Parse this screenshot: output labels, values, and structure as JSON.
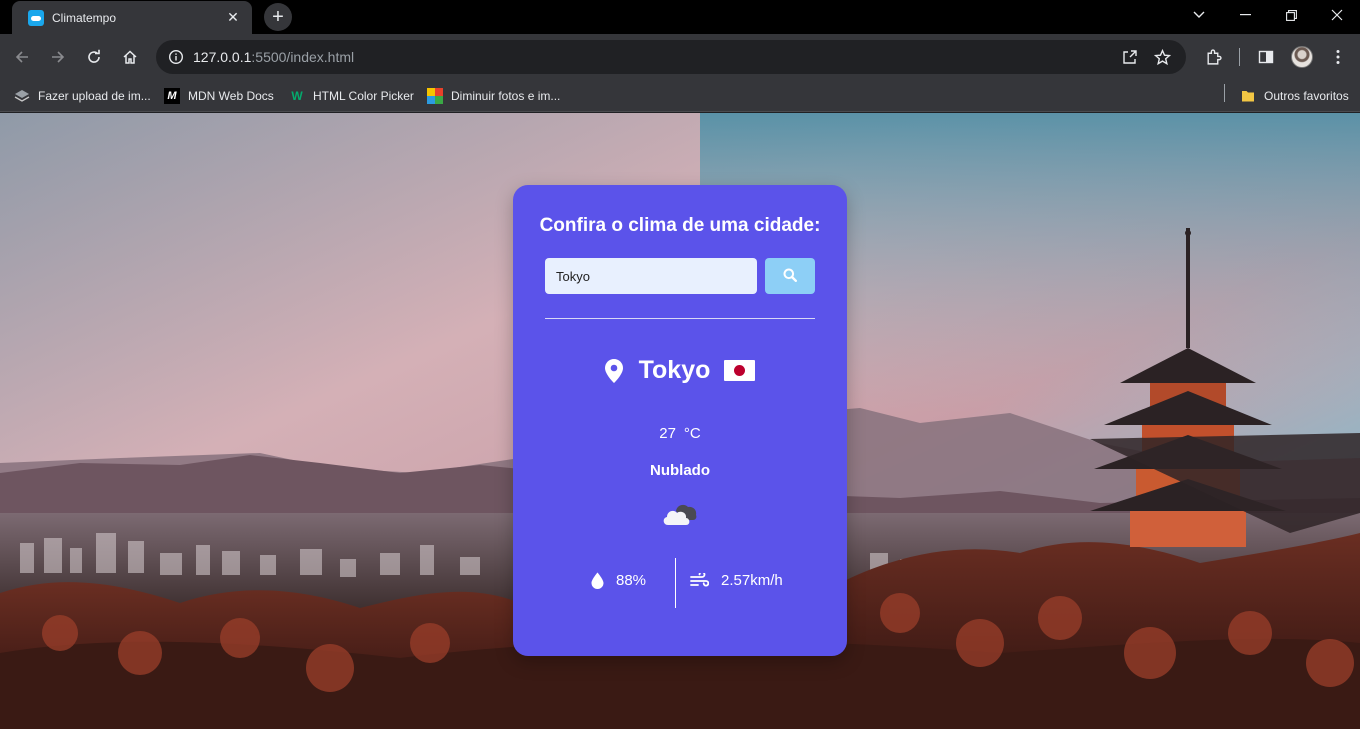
{
  "browser": {
    "tab": {
      "title": "Climatempo",
      "favicon": "cloud-favicon-icon"
    },
    "url": {
      "host": "127.0.0.1",
      "path": ":5500/index.html"
    },
    "bookmarks": [
      {
        "label": "Fazer upload de im...",
        "icon": "stack-icon"
      },
      {
        "label": "MDN Web Docs",
        "icon": "mdn-icon"
      },
      {
        "label": "HTML Color Picker",
        "icon": "w3-icon"
      },
      {
        "label": "Diminuir fotos e im...",
        "icon": "easy-icon"
      }
    ],
    "other_bookmarks": "Outros favoritos"
  },
  "app": {
    "heading": "Confira o clima de uma cidade:",
    "search": {
      "value": "Tokyo",
      "icon": "search-icon"
    },
    "weather": {
      "city": "Tokyo",
      "country_flag": "jp",
      "temperature": "27",
      "unit": "°C",
      "description": "Nublado",
      "icon": "cloudy-icon",
      "humidity": "88%",
      "wind": "2.57km/h"
    }
  },
  "colors": {
    "card": "#5b53ea",
    "search_button": "#8dcff6",
    "input": "#e8f0fe"
  }
}
